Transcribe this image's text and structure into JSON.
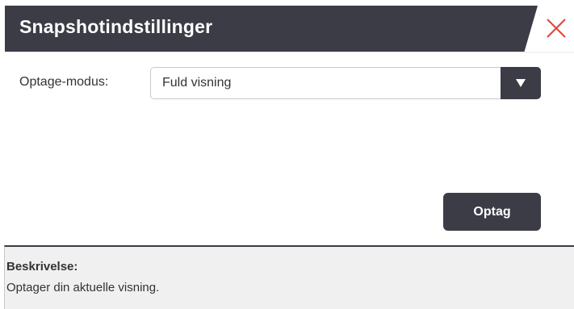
{
  "dialog": {
    "title": "Snapshotindstillinger",
    "close_icon": "close-icon"
  },
  "form": {
    "mode_label": "Optage-modus:",
    "mode_value": "Fuld visning",
    "dropdown_icon": "caret-down-icon"
  },
  "actions": {
    "record_label": "Optag"
  },
  "description": {
    "title": "Beskrivelse:",
    "text": "Optager din aktuelle visning."
  },
  "colors": {
    "header_bg": "#3b3c45",
    "close_icon": "#e0443a",
    "panel_bg": "#f0f0f0"
  }
}
